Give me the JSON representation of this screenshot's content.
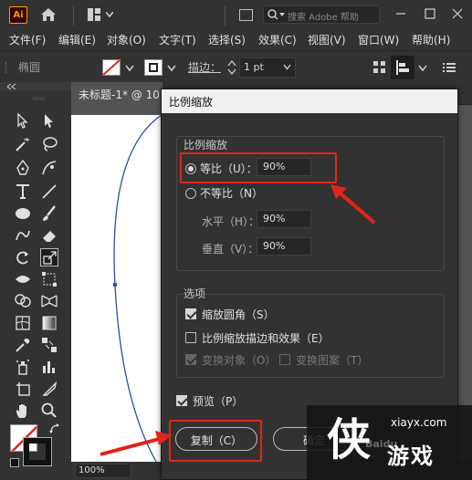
{
  "app": {
    "logo": "Ai"
  },
  "search": {
    "placeholder": "搜索 Adobe 帮助"
  },
  "menu": [
    "文件(F)",
    "编辑(E)",
    "对象(O)",
    "文字(T)",
    "选择(S)",
    "效果(C)",
    "视图(V)",
    "窗口(W)",
    "帮助(H)"
  ],
  "control_bar": {
    "shape_label": "椭圆",
    "stroke_label": "描边：",
    "stroke_value": "1 pt"
  },
  "document": {
    "tab_title": "未标题-1* @ 10",
    "zoom": "100%"
  },
  "dialog": {
    "title": "比例缩放",
    "scale_group": {
      "title": "比例缩放",
      "uniform_label": "等比（U）：",
      "uniform_value": "90%",
      "non_uniform_label": "不等比（N）",
      "horizontal_label": "水平（H）：",
      "horizontal_value": "90%",
      "vertical_label": "垂直（V）：",
      "vertical_value": "90%"
    },
    "options_group": {
      "title": "选项",
      "scale_corners": "缩放圆角（S）",
      "scale_strokes": "比例缩放描边和效果（E）",
      "transform_objects": "变换对象（O）",
      "transform_patterns": "变换图案（T）"
    },
    "preview_label": "预览（P）",
    "copy_button": "复制（C）",
    "ok_button": "确定"
  },
  "watermark": {
    "url": "xiayx.com",
    "text": "游戏",
    "glyph": "侠",
    "overlay": "Baidu"
  },
  "colors": {
    "highlight": "#e2241b",
    "logo_orange": "#ff9a00",
    "ui_dark": "#323232",
    "ui_mid": "#535353"
  }
}
